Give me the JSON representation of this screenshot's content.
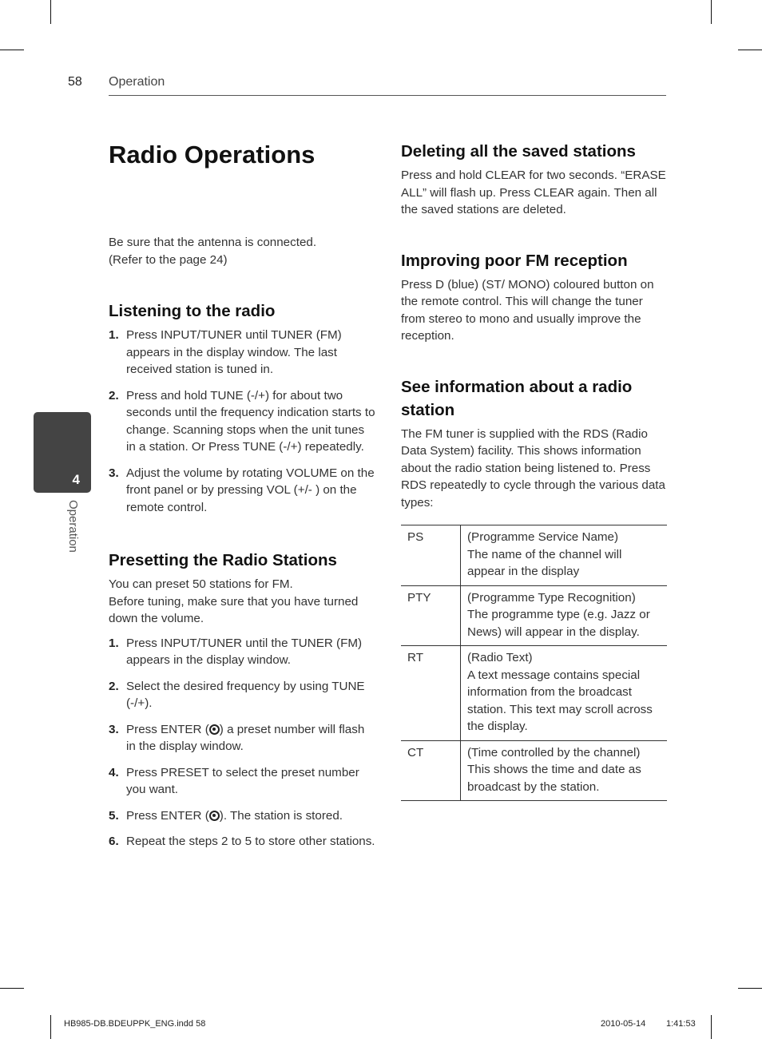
{
  "header": {
    "page_number": "58",
    "section": "Operation"
  },
  "side_tab": {
    "chapter_number": "4",
    "label": "Operation"
  },
  "title": "Radio Operations",
  "intro": [
    "Be sure that the antenna is connected.",
    "(Refer to the page 24)"
  ],
  "listening": {
    "heading": "Listening to the radio",
    "steps": [
      {
        "num": "1.",
        "text": "Press INPUT/TUNER until TUNER (FM) appears in the display window. The last received station is tuned in."
      },
      {
        "num": "2.",
        "text": "Press and hold TUNE (-/+) for about two seconds until the frequency indication starts to change. Scanning stops when the unit tunes in a station. Or Press TUNE (-/+) repeatedly."
      },
      {
        "num": "3.",
        "text": "Adjust the volume by rotating VOLUME on the front panel or by pressing VOL (+/- ) on the remote control."
      }
    ]
  },
  "presetting": {
    "heading": "Presetting the Radio Stations",
    "intro": [
      "You can preset 50 stations for FM.",
      "Before tuning, make sure that you have turned down the volume."
    ],
    "steps": [
      {
        "num": "1.",
        "text": "Press INPUT/TUNER until the TUNER (FM) appears in the display window."
      },
      {
        "num": "2.",
        "text": "Select the desired frequency by using TUNE (-/+)."
      },
      {
        "num": "3.",
        "pre": "Press ENTER (",
        "post": ") a preset number will flash in the display window."
      },
      {
        "num": "4.",
        "text": "Press PRESET to select the preset number you want."
      },
      {
        "num": "5.",
        "pre": "Press ENTER (",
        "post": "). The station is stored."
      },
      {
        "num": "6.",
        "text": "Repeat the steps 2 to 5 to store other stations."
      }
    ]
  },
  "deleting": {
    "heading": "Deleting all the saved stations",
    "body": "Press and hold CLEAR for two seconds. “ERASE ALL” will flash up. Press CLEAR again. Then all the saved stations are deleted."
  },
  "improving": {
    "heading": "Improving poor FM reception",
    "body": "Press D (blue) (ST/ MONO) coloured button on the remote control. This will change the tuner from stereo to mono and usually improve the reception."
  },
  "rds": {
    "heading": "See information about a radio station",
    "body": "The FM tuner is supplied with the RDS (Radio Data System) facility. This shows information about the radio station being listened to. Press RDS repeatedly to cycle through the various data types:",
    "table": [
      {
        "code": "PS",
        "title": "(Programme Service Name)",
        "desc": "The name of the channel will appear in the display"
      },
      {
        "code": "PTY",
        "title": "(Programme Type Recognition)",
        "desc": "The programme type (e.g. Jazz or News) will appear in the display."
      },
      {
        "code": "RT",
        "title": "(Radio Text)",
        "desc": "A text message contains special information from the broadcast station. This text may scroll across the display."
      },
      {
        "code": "CT",
        "title": "(Time controlled by the channel)",
        "desc": "This shows the time and date as broadcast by the station."
      }
    ]
  },
  "footer": {
    "file": "HB985-DB.BDEUPPK_ENG.indd   58",
    "date": "2010-05-14",
    "time": "1:41:53"
  }
}
